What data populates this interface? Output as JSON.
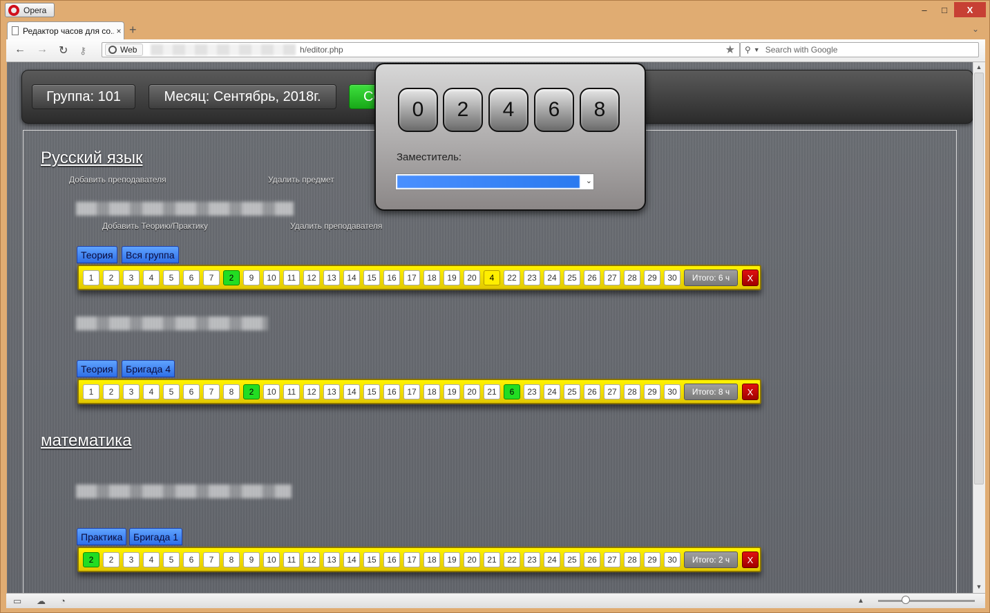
{
  "browser": {
    "app_name": "Opera",
    "tab_title": "Редактор часов для со...",
    "tab_close": "×",
    "new_tab": "+",
    "web_badge": "Web",
    "url_tail": "h/editor.php",
    "search_placeholder": "Search with Google",
    "win_min": "–",
    "win_max": "□",
    "win_close": "X"
  },
  "topbar": {
    "group": "Группа: 101",
    "month": "Месяц: Сентябрь, 2018г.",
    "green_btn": "Со"
  },
  "popup": {
    "digits": [
      "0",
      "2",
      "4",
      "6",
      "8"
    ],
    "deputy_label": "Заместитель:"
  },
  "subjects": [
    {
      "title": "Русский язык",
      "add_teacher": "Добавить преподавателя",
      "delete_subject": "Удалить предмет",
      "add_theory": "Добавить Теорию/Практику",
      "delete_teacher": "Удалить преподавателя",
      "rows": [
        {
          "type": "Теория",
          "group": "Вся группа",
          "itogo": "Итого: 6 ч",
          "x": "X"
        },
        {
          "type": "Теория",
          "group": "Бригада 4",
          "itogo": "Итого: 8 ч",
          "x": "X"
        }
      ]
    },
    {
      "title": "математика",
      "rows": [
        {
          "type": "Практика",
          "group": "Бригада 1",
          "itogo": "Итого: 2 ч",
          "x": "X"
        }
      ]
    }
  ],
  "day_rows": [
    {
      "cells": [
        "1",
        "2",
        "3",
        "4",
        "5",
        "6",
        "7",
        "2",
        "9",
        "10",
        "11",
        "12",
        "13",
        "14",
        "15",
        "16",
        "17",
        "18",
        "19",
        "20",
        "4",
        "22",
        "23",
        "24",
        "25",
        "26",
        "27",
        "28",
        "29",
        "30"
      ],
      "green": [
        7
      ],
      "yellow": [
        20
      ]
    },
    {
      "cells": [
        "1",
        "2",
        "3",
        "4",
        "5",
        "6",
        "7",
        "8",
        "2",
        "10",
        "11",
        "12",
        "13",
        "14",
        "15",
        "16",
        "17",
        "18",
        "19",
        "20",
        "21",
        "6",
        "23",
        "24",
        "25",
        "26",
        "27",
        "28",
        "29",
        "30"
      ],
      "green": [
        8,
        21
      ],
      "yellow": []
    },
    {
      "cells": [
        "2",
        "2",
        "3",
        "4",
        "5",
        "6",
        "7",
        "8",
        "9",
        "10",
        "11",
        "12",
        "13",
        "14",
        "15",
        "16",
        "17",
        "18",
        "19",
        "20",
        "21",
        "22",
        "23",
        "24",
        "25",
        "26",
        "27",
        "28",
        "29",
        "30"
      ],
      "green": [
        0
      ],
      "yellow": []
    }
  ],
  "colors": {
    "highlight_green": "#22dd22",
    "highlight_yellow": "#ffee00",
    "bar_yellow": "#fff300",
    "chip_blue": "#2e6fe8"
  }
}
